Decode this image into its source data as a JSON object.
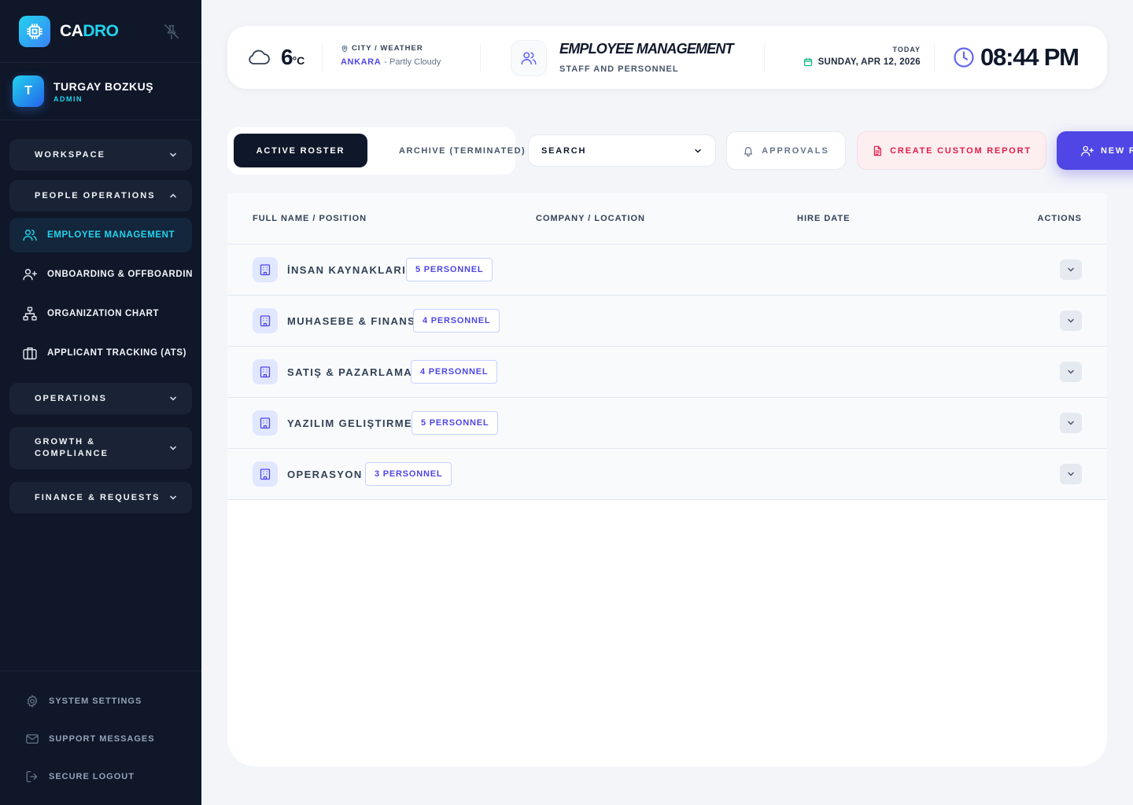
{
  "sidebar": {
    "brand": {
      "part1": "CA",
      "part2": "DRO"
    },
    "profile": {
      "initial": "T",
      "name": "TURGAY BOZKUŞ",
      "role": "ADMIN"
    },
    "groups": {
      "workspace": "WORKSPACE",
      "people_operations": "PEOPLE OPERATIONS",
      "operations": "OPERATIONS",
      "growth_line1": "GROWTH &",
      "growth_line2": "COMPLIANCE",
      "finance": "FINANCE & REQUESTS"
    },
    "people_items": [
      {
        "label": "EMPLOYEE MANAGEMENT",
        "icon": "users-icon",
        "active": true
      },
      {
        "label": "ONBOARDING & OFFBOARDING",
        "icon": "user-plus-icon",
        "active": false
      },
      {
        "label": "ORGANIZATION CHART",
        "icon": "org-chart-icon",
        "active": false
      },
      {
        "label": "APPLICANT TRACKING (ATS)",
        "icon": "briefcase-icon",
        "active": false
      }
    ],
    "footer": {
      "settings": "SYSTEM SETTINGS",
      "support": "SUPPORT MESSAGES",
      "logout": "SECURE LOGOUT"
    }
  },
  "header": {
    "temperature": "6",
    "temperature_unit": "°C",
    "city_title": "CITY / WEATHER",
    "city": "ANKARA",
    "condition": "- Partly Cloudy",
    "page_title": "EMPLOYEE MANAGEMENT",
    "page_subtitle": "STAFF AND PERSONNEL",
    "today_label": "TODAY",
    "date": "SUNDAY, APR 12, 2026",
    "time": "08:44 PM"
  },
  "toolbar": {
    "tab_active": "ACTIVE ROSTER",
    "tab_archive": "ARCHIVE (TERMINATED)",
    "search_label": "SEARCH",
    "approvals": "APPROVALS",
    "create_report": "CREATE CUSTOM REPORT",
    "new_button": "NEW R"
  },
  "table": {
    "columns": [
      "FULL NAME / POSITION",
      "COMPANY / LOCATION",
      "HIRE DATE",
      "ACTIONS"
    ],
    "departments": [
      {
        "name": "İNSAN KAYNAKLARI",
        "badge": "5 PERSONNEL"
      },
      {
        "name": "MUHASEBE & FINANS",
        "badge": "4 PERSONNEL"
      },
      {
        "name": "SATIŞ & PAZARLAMA",
        "badge": "4 PERSONNEL"
      },
      {
        "name": "YAZILIM GELIŞTIRME",
        "badge": "5 PERSONNEL"
      },
      {
        "name": "OPERASYON",
        "badge": "3 PERSONNEL"
      }
    ]
  },
  "colors": {
    "sidebar_bg": "#0f1729",
    "accent_cyan": "#22d3ee",
    "accent_indigo": "#4f46e5",
    "danger": "#e11d48"
  }
}
